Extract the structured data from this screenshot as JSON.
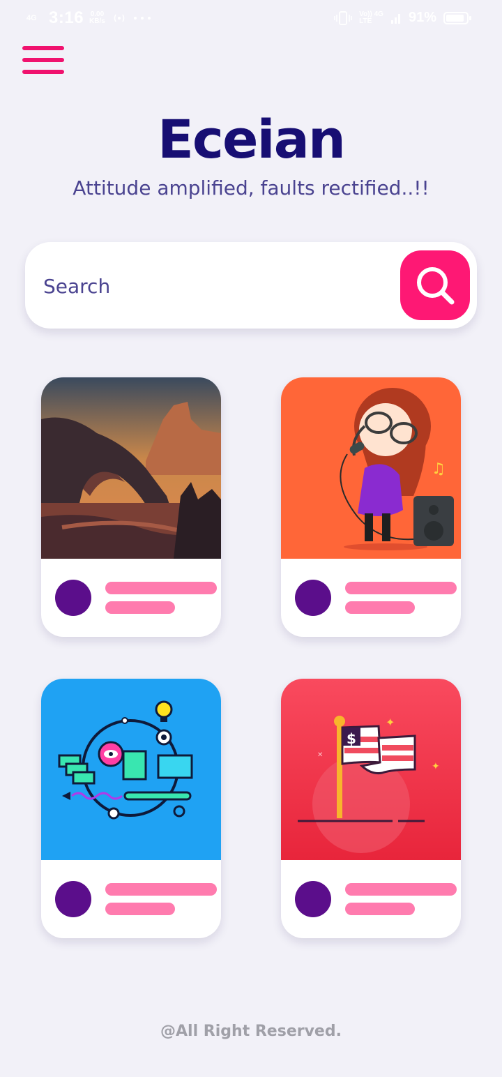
{
  "status_bar": {
    "network": "4G",
    "time": "3:16",
    "speed_value": "0.00",
    "speed_unit": "KB/s",
    "carrier": "Vo)) 4G",
    "lte": "LTE",
    "battery": "91%",
    "battery_level": 0.91
  },
  "header": {
    "title": "Eceian",
    "tagline": "Attitude amplified, faults rectified..!!"
  },
  "search": {
    "placeholder": "Search"
  },
  "cards": [
    {
      "image": "desert-canyon-arch-illustration"
    },
    {
      "image": "girl-singing-with-microphone-illustration"
    },
    {
      "image": "creative-ideas-icons-illustration"
    },
    {
      "image": "american-flag-dollar-illustration"
    }
  ],
  "footer": {
    "text": "@All Right Reserved."
  },
  "colors": {
    "accent": "#FE1874",
    "title": "#170E73",
    "avatar": "#5B0E8B",
    "placeholder_lines": "#FF7BAE",
    "background": "#F2F1F8"
  }
}
